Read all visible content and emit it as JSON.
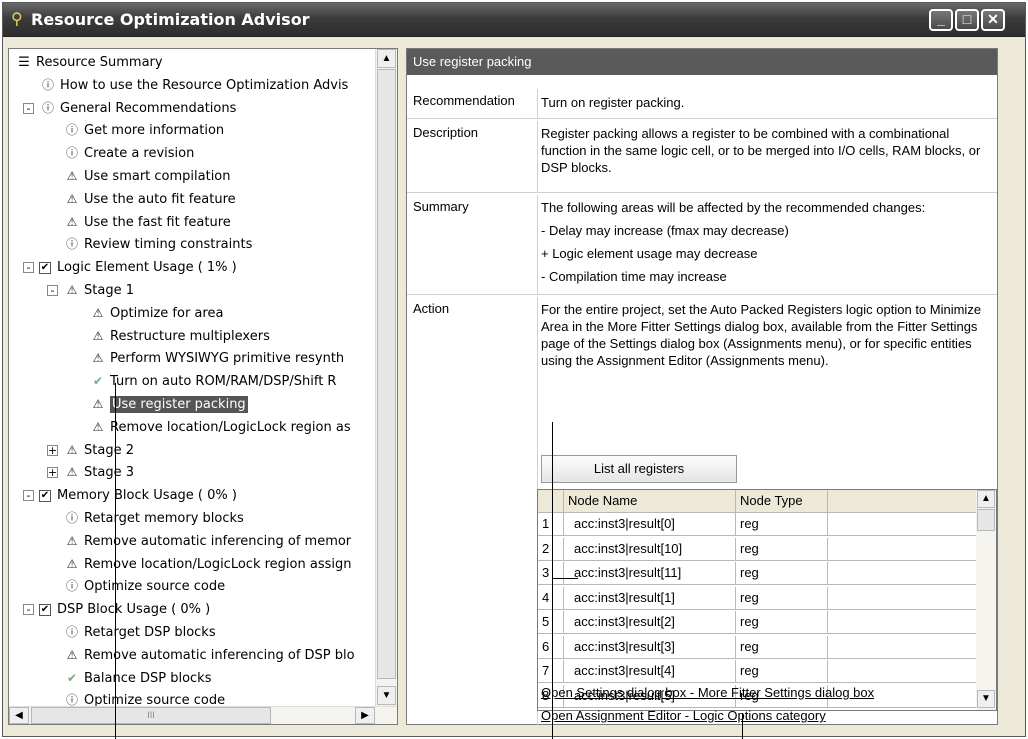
{
  "window": {
    "title": "Resource Optimization Advisor"
  },
  "tree": {
    "items": [
      {
        "label": "Resource Summary",
        "icon": "doc-icon"
      },
      {
        "label": "How to use the Resource Optimization Advis",
        "icon": "info-icon"
      },
      {
        "label": "General Recommendations",
        "icon": "info-icon"
      },
      {
        "label": "Get more information",
        "icon": "info-icon"
      },
      {
        "label": "Create a revision",
        "icon": "info-icon"
      },
      {
        "label": "Use smart compilation",
        "icon": "warning-icon"
      },
      {
        "label": "Use the auto fit feature",
        "icon": "warning-icon"
      },
      {
        "label": "Use the fast fit feature",
        "icon": "warning-icon"
      },
      {
        "label": "Review timing constraints",
        "icon": "info-icon"
      },
      {
        "label": "Logic Element Usage ( 1% )",
        "icon": "checkbox-icon"
      },
      {
        "label": "Stage 1",
        "icon": "warning-icon"
      },
      {
        "label": "Optimize for area",
        "icon": "warning-icon"
      },
      {
        "label": "Restructure multiplexers",
        "icon": "warning-icon"
      },
      {
        "label": "Perform WYSIWYG primitive resynth",
        "icon": "warning-icon"
      },
      {
        "label": "Turn on auto ROM/RAM/DSP/Shift R",
        "icon": "check-icon"
      },
      {
        "label": "Use register packing",
        "icon": "warning-icon"
      },
      {
        "label": "Remove location/LogicLock region as",
        "icon": "warning-icon"
      },
      {
        "label": "Stage 2",
        "icon": "warning-icon"
      },
      {
        "label": "Stage 3",
        "icon": "warning-icon"
      },
      {
        "label": "Memory Block Usage ( 0% )",
        "icon": "checkbox-icon"
      },
      {
        "label": "Retarget memory blocks",
        "icon": "info-icon"
      },
      {
        "label": "Remove automatic inferencing of memor",
        "icon": "warning-icon"
      },
      {
        "label": "Remove location/LogicLock region assign",
        "icon": "warning-icon"
      },
      {
        "label": "Optimize source code",
        "icon": "info-icon"
      },
      {
        "label": "DSP Block Usage ( 0% )",
        "icon": "checkbox-icon"
      },
      {
        "label": "Retarget DSP blocks",
        "icon": "info-icon"
      },
      {
        "label": "Remove automatic inferencing of DSP blo",
        "icon": "warning-icon"
      },
      {
        "label": "Balance DSP blocks",
        "icon": "check-icon"
      },
      {
        "label": "Optimize source code",
        "icon": "info-icon"
      }
    ],
    "hscroll_grip": "III"
  },
  "detail": {
    "header": "Use register packing",
    "recommendation_label": "Recommendation",
    "recommendation_text": "Turn on register packing.",
    "description_label": "Description",
    "description_text": "Register packing allows a register to be combined with a combinational function in the same logic cell, or to be merged into I/O cells, RAM blocks, or DSP blocks.",
    "summary_label": "Summary",
    "summary_lines": [
      "The following areas will be affected by the recommended changes:",
      "- Delay may increase (fmax may decrease)",
      "+ Logic element usage may decrease",
      "- Compilation time may increase"
    ],
    "action_label": "Action",
    "action_text": "For the entire project, set the Auto Packed Registers logic option to Minimize Area in the More Fitter Settings dialog box, available from the Fitter Settings page of the Settings dialog box (Assignments menu), or for specific entities using the Assignment Editor (Assignments menu).",
    "list_button": "List all registers",
    "grid": {
      "columns": [
        "Node Name",
        "Node Type"
      ],
      "rows": [
        {
          "idx": "1",
          "name": "acc:inst3|result[0]",
          "type": "reg"
        },
        {
          "idx": "2",
          "name": "acc:inst3|result[10]",
          "type": "reg"
        },
        {
          "idx": "3",
          "name": "acc:inst3|result[11]",
          "type": "reg"
        },
        {
          "idx": "4",
          "name": "acc:inst3|result[1]",
          "type": "reg"
        },
        {
          "idx": "5",
          "name": "acc:inst3|result[2]",
          "type": "reg"
        },
        {
          "idx": "6",
          "name": "acc:inst3|result[3]",
          "type": "reg"
        },
        {
          "idx": "7",
          "name": "acc:inst3|result[4]",
          "type": "reg"
        },
        {
          "idx": "8",
          "name": "acc:inst3|result[5]",
          "type": "reg"
        }
      ]
    },
    "link1": "Open Settings dialog box - More Fitter Settings dialog box",
    "link2": "Open Assignment Editor - Logic Options category"
  }
}
